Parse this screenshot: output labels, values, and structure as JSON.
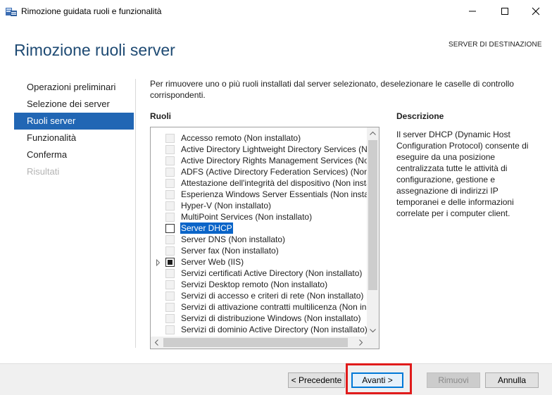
{
  "window": {
    "title": "Rimozione guidata ruoli e funzionalità",
    "app_icon": "server-manager-icon",
    "controls": {
      "minimize_icon": "minimize-icon",
      "maximize_icon": "maximize-icon",
      "close_icon": "close-icon"
    }
  },
  "header": {
    "title": "Rimozione ruoli server",
    "destination_label": "SERVER DI DESTINAZIONE"
  },
  "nav": {
    "items": [
      {
        "label": "Operazioni preliminari",
        "state": "normal"
      },
      {
        "label": "Selezione dei server",
        "state": "normal"
      },
      {
        "label": "Ruoli server",
        "state": "active"
      },
      {
        "label": "Funzionalità",
        "state": "normal"
      },
      {
        "label": "Conferma",
        "state": "normal"
      },
      {
        "label": "Risultati",
        "state": "disabled"
      }
    ]
  },
  "main": {
    "intro": "Per rimuovere uno o più ruoli installati dal server selezionato, deselezionare le caselle di controllo corrispondenti.",
    "roles_heading": "Ruoli",
    "roles": [
      {
        "label": "Accesso remoto (Non installato)"
      },
      {
        "label": "Active Directory Lightweight Directory Services (Non installato)"
      },
      {
        "label": "Active Directory Rights Management Services (Non installato)"
      },
      {
        "label": "ADFS (Active Directory Federation Services) (Non installato)"
      },
      {
        "label": "Attestazione dell'integrità del dispositivo (Non installato)"
      },
      {
        "label": "Esperienza Windows Server Essentials (Non installato)"
      },
      {
        "label": "Hyper-V (Non installato)"
      },
      {
        "label": "MultiPoint Services (Non installato)"
      },
      {
        "label": "Server DHCP",
        "enabled": true,
        "checked": false,
        "selected": true
      },
      {
        "label": "Server DNS (Non installato)"
      },
      {
        "label": "Server fax (Non installato)"
      },
      {
        "label": "Server Web (IIS)",
        "enabled": true,
        "partial": true,
        "expandable": true
      },
      {
        "label": "Servizi certificati Active Directory (Non installato)"
      },
      {
        "label": "Servizi Desktop remoto (Non installato)"
      },
      {
        "label": "Servizi di accesso e criteri di rete (Non installato)"
      },
      {
        "label": "Servizi di attivazione contratti multilicenza (Non installato)"
      },
      {
        "label": "Servizi di distribuzione Windows (Non installato)"
      },
      {
        "label": "Servizi di dominio Active Directory (Non installato)"
      }
    ],
    "description_heading": "Descrizione",
    "description": "Il server DHCP (Dynamic Host Configuration Protocol) consente di eseguire da una posizione centralizzata tutte le attività di configurazione, gestione e assegnazione di indirizzi IP temporanei e delle informazioni correlate per i computer client."
  },
  "footer": {
    "prev_label": "< Precedente",
    "next_label": "Avanti >",
    "remove_label": "Rimuovi",
    "cancel_label": "Annulla"
  },
  "colors": {
    "accent": "#2166b4",
    "selection": "#0a64c8",
    "highlight_box": "#e01b1b"
  }
}
